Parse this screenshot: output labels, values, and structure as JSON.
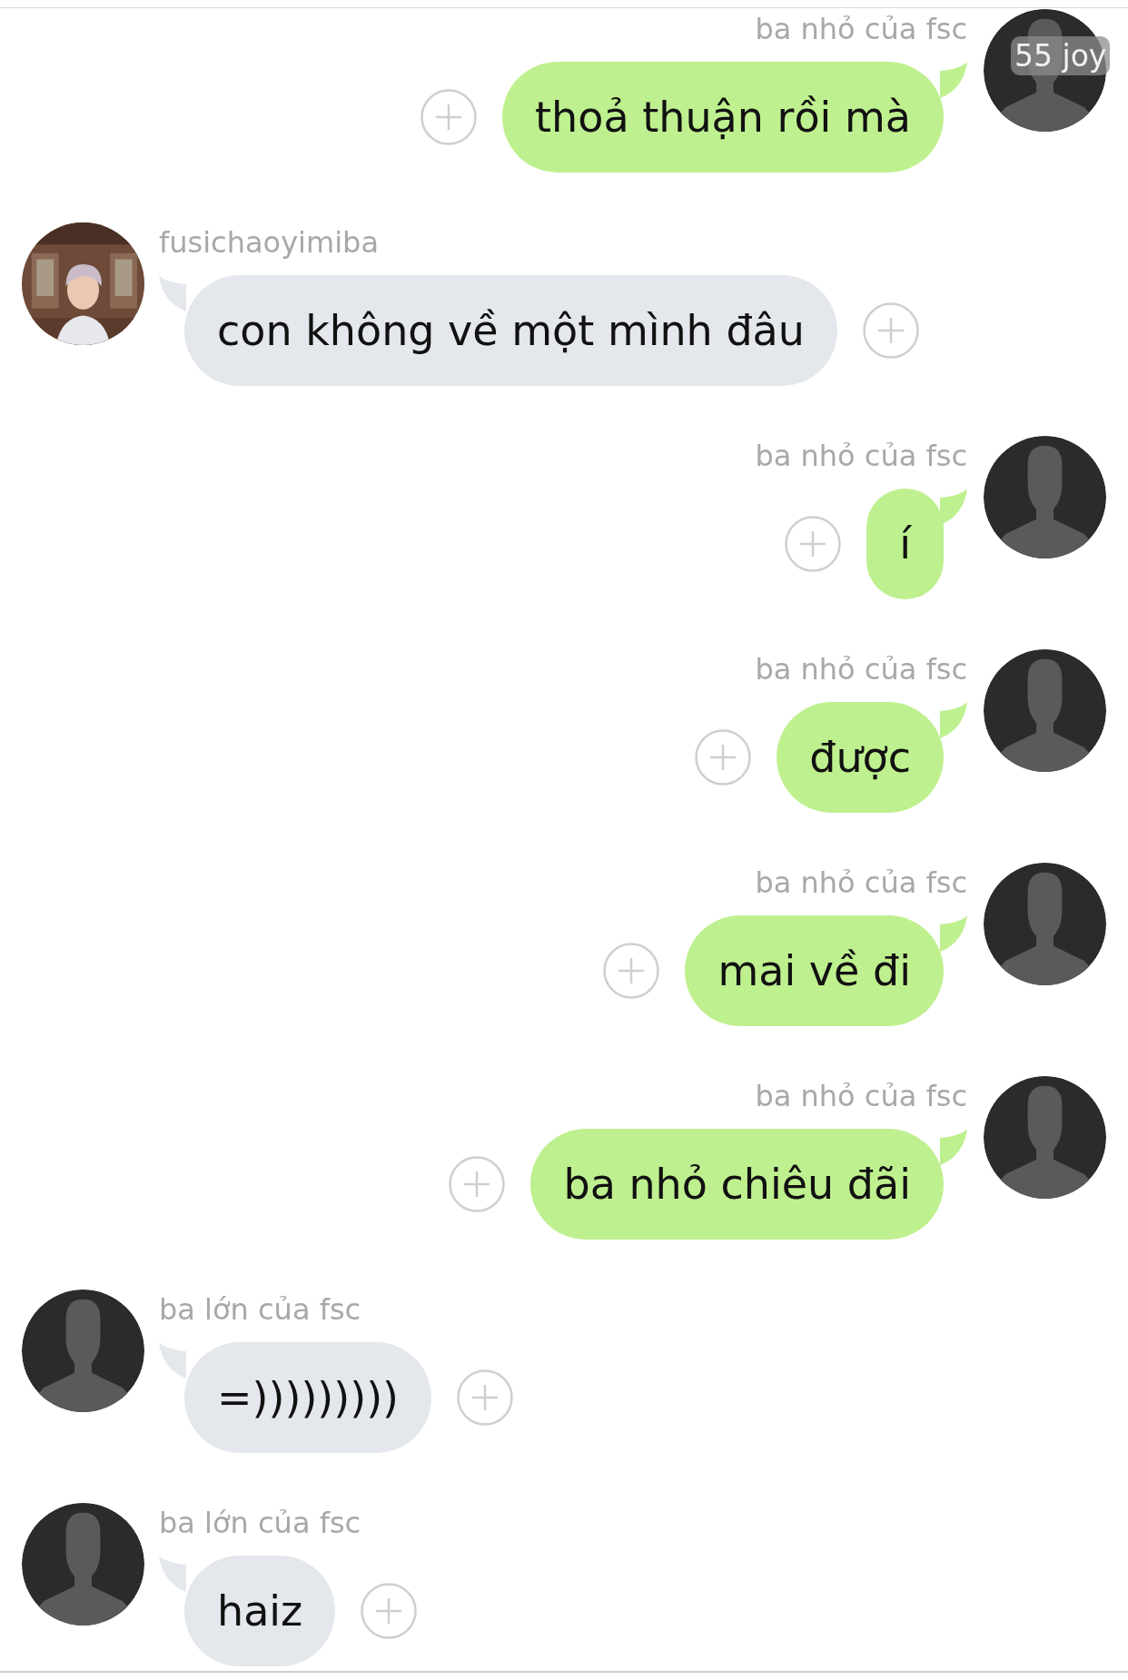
{
  "messages": [
    {
      "kind": "outgoing",
      "sender": "ba nhỏ của fsc",
      "text": "thoả thuận rồi mà",
      "avatar": {
        "kind": "silhouette"
      },
      "badge": "55 joy"
    },
    {
      "kind": "incoming",
      "sender": "fusichaoyimiba",
      "text": "con không về một mình đâu"
    },
    {
      "kind": "outgoing",
      "sender": "ba nhỏ của fsc",
      "text": "í",
      "avatar": {
        "kind": "silhouette"
      }
    },
    {
      "kind": "outgoing",
      "sender": "ba nhỏ của fsc",
      "text": "được",
      "avatar": {
        "kind": "silhouette"
      }
    },
    {
      "kind": "outgoing",
      "sender": "ba nhỏ của fsc",
      "text": "mai về đi",
      "avatar": {
        "kind": "silhouette"
      }
    },
    {
      "kind": "outgoing",
      "sender": "ba nhỏ của fsc",
      "text": "ba nhỏ chiêu đãi",
      "avatar": {
        "kind": "silhouette"
      }
    },
    {
      "kind": "incoming",
      "sender": "ba lớn của fsc",
      "text": "=)))))))))",
      "avatar": {
        "kind": "silhouette"
      }
    },
    {
      "kind": "incoming",
      "sender": "ba lớn của fsc",
      "text": "haiz",
      "avatar": {
        "kind": "silhouette"
      }
    }
  ]
}
